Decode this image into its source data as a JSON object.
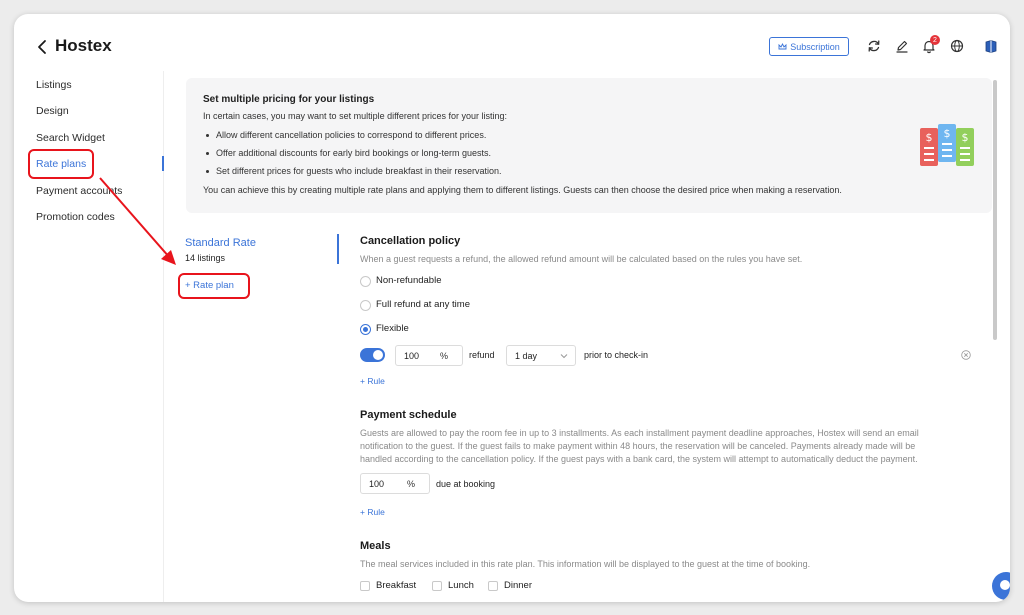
{
  "app": {
    "title": "Hostex"
  },
  "header": {
    "subscription_label": "Subscription",
    "notification_count": "2",
    "icons": [
      "back-chevron-icon",
      "refresh-icon",
      "edit-icon",
      "bell-icon",
      "globe-icon",
      "book-icon"
    ]
  },
  "sidebar": {
    "items": [
      {
        "label": "Listings"
      },
      {
        "label": "Design"
      },
      {
        "label": "Search Widget"
      },
      {
        "label": "Rate plans",
        "active": true
      },
      {
        "label": "Payment accounts"
      },
      {
        "label": "Promotion codes"
      }
    ]
  },
  "info": {
    "title": "Set multiple pricing for your listings",
    "intro": "In certain cases, you may want to set multiple different prices for your listing:",
    "bullets": [
      "Allow different cancellation policies to correspond to different prices.",
      "Offer additional discounts for early bird bookings or long-term guests.",
      "Set different prices for guests who include breakfast in their reservation."
    ],
    "outro": "You can achieve this by creating multiple rate plans and applying them to different listings. Guests can then choose the desired price when making a reservation."
  },
  "rate_plans": {
    "current_name": "Standard Rate",
    "current_count": "14 listings",
    "add_label": "+ Rate plan"
  },
  "cancellation": {
    "title": "Cancellation policy",
    "description": "When a guest requests a refund, the allowed refund amount will be calculated based on the rules you have set.",
    "options": [
      {
        "label": "Non-refundable",
        "selected": false
      },
      {
        "label": "Full refund at any time",
        "selected": false
      },
      {
        "label": "Flexible",
        "selected": true
      }
    ],
    "rule": {
      "enabled": true,
      "percent": "100",
      "percent_unit": "%",
      "refund_label": "refund",
      "period": "1 day",
      "suffix": "prior to check-in"
    },
    "add_rule_label": "+ Rule"
  },
  "payment": {
    "title": "Payment schedule",
    "description_lines": [
      "Guests are allowed to pay the room fee in up to 3 installments. As each installment payment deadline approaches, Hostex will send an email",
      "notification to the guest. If the guest fails to make payment within 48 hours, the reservation will be canceled. Payments already made will be",
      "handled according to the cancellation policy. If the guest pays with a bank card, the system will attempt to automatically deduct the payment."
    ],
    "percent": "100",
    "percent_unit": "%",
    "due_label": "due at booking",
    "add_rule_label": "+ Rule"
  },
  "meals": {
    "title": "Meals",
    "description": "The meal services included in this rate plan. This information will be displayed to the guest at the time of booking.",
    "options": [
      {
        "label": "Breakfast",
        "checked": false
      },
      {
        "label": "Lunch",
        "checked": false
      },
      {
        "label": "Dinner",
        "checked": false
      }
    ]
  },
  "colors": {
    "accent": "#3b74d8",
    "annotation": "#e8141c",
    "badge": "#e5343a"
  }
}
